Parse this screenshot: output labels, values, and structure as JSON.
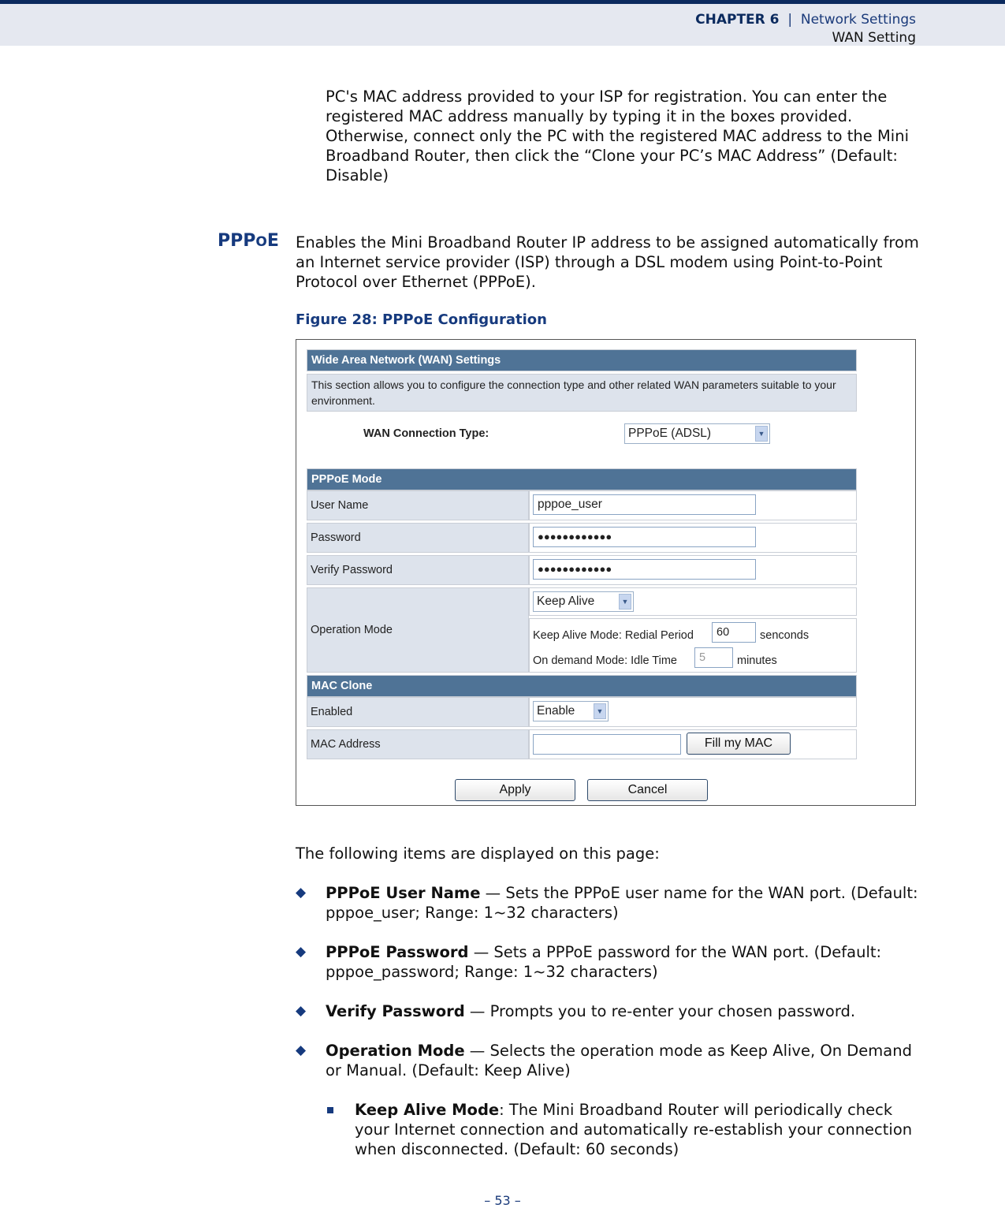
{
  "header": {
    "chapter": "CHAPTER 6",
    "separator": "|",
    "section": "Network Settings",
    "subsection": "WAN Setting"
  },
  "intro_paragraph": "PC's MAC address provided to your ISP for registration. You can enter the registered MAC address manually by typing it in the boxes provided. Otherwise, connect only the PC with the registered MAC address to the Mini Broadband Router, then click the “Clone your PC’s MAC Address” (Default: Disable)",
  "section": {
    "title_main": "PPP",
    "title_small": "O",
    "title_end": "E",
    "description": "Enables the Mini Broadband Router IP address to be assigned automatically from an Internet service provider (ISP) through a DSL modem using Point-to-Point Protocol over Ethernet (PPPoE)."
  },
  "figure": {
    "caption": "Figure 28:  PPPoE Configuration",
    "wan_header": "Wide Area Network (WAN) Settings",
    "wan_description": "This section allows you to configure the connection type and other related WAN parameters suitable to your environment.",
    "connection_type_label": "WAN Connection Type:",
    "connection_type_value": "PPPoE (ADSL)",
    "pppoe_header": "PPPoE Mode",
    "user_name_label": "User Name",
    "user_name_value": "pppoe_user",
    "password_label": "Password",
    "password_value": "●●●●●●●●●●●●",
    "verify_password_label": "Verify Password",
    "verify_password_value": "●●●●●●●●●●●●",
    "operation_mode_label": "Operation Mode",
    "operation_mode_value": "Keep Alive",
    "keep_alive_label": "Keep Alive Mode: Redial Period",
    "keep_alive_value": "60",
    "keep_alive_unit": "senconds",
    "on_demand_label": "On demand Mode: Idle Time",
    "on_demand_value": "5",
    "on_demand_unit": "minutes",
    "mac_header": "MAC Clone",
    "enabled_label": "Enabled",
    "enabled_value": "Enable",
    "mac_address_label": "MAC Address",
    "mac_address_value": "",
    "fill_mac_button": "Fill my MAC",
    "apply_button": "Apply",
    "cancel_button": "Cancel"
  },
  "items_intro": "The following items are displayed on this page:",
  "bullets": [
    {
      "term": "PPPoE User Name",
      "text": " — Sets the PPPoE user name for the WAN port. (Default: pppoe_user; Range: 1~32 characters)"
    },
    {
      "term": "PPPoE Password",
      "text": " — Sets a PPPoE password for the WAN port. (Default: pppoe_password; Range: 1~32 characters)"
    },
    {
      "term": "Verify Password",
      "text": " — Prompts you to re-enter your chosen password."
    },
    {
      "term": "Operation Mode",
      "text": " — Selects the operation mode as Keep Alive, On Demand or Manual. (Default: Keep Alive)"
    }
  ],
  "sub_bullets": [
    {
      "term": "Keep Alive Mode",
      "text": ": The Mini Broadband Router will periodically check your Internet connection and automatically re-establish your connection when disconnected. (Default: 60 seconds)"
    }
  ],
  "page_number": "–  53  –",
  "icons": {
    "bullet": "◆",
    "dropdown": "⌄"
  }
}
